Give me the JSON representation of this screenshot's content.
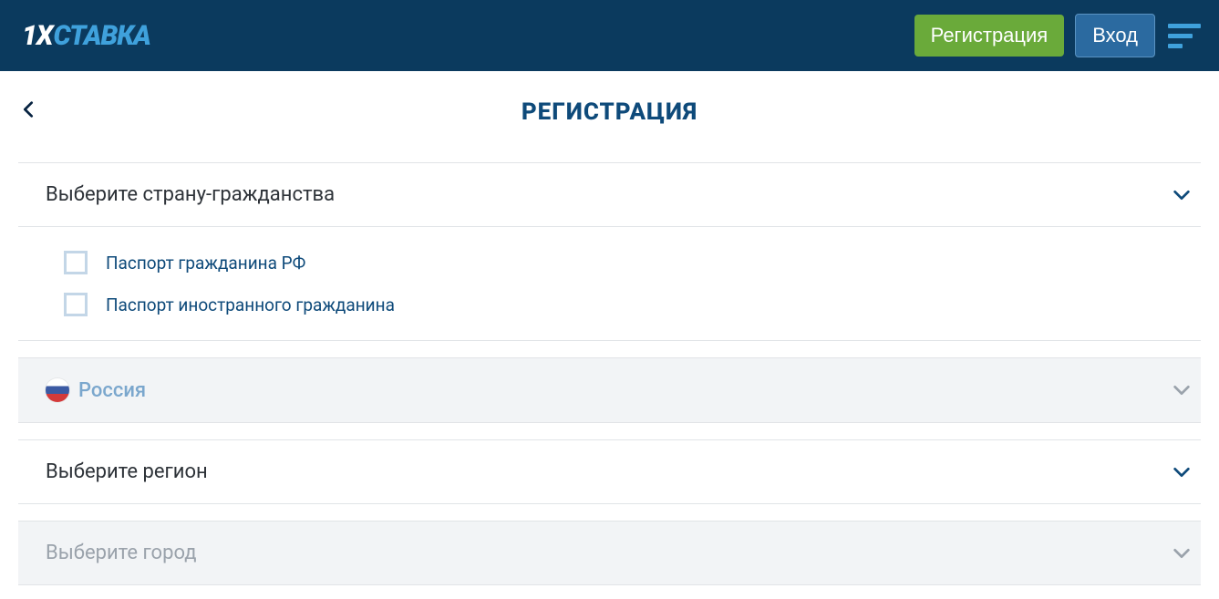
{
  "header": {
    "logo_prefix": "1X",
    "logo_text": "СТАВКА",
    "register_label": "Регистрация",
    "login_label": "Вход"
  },
  "page": {
    "title": "РЕГИСТРАЦИЯ"
  },
  "form": {
    "citizenship_label": "Выберите страну-гражданства",
    "passport_options": [
      "Паспорт гражданина РФ",
      "Паспорт иностранного гражданина"
    ],
    "country_selected": "Россия",
    "region_label": "Выберите регион",
    "city_label": "Выберите город"
  }
}
